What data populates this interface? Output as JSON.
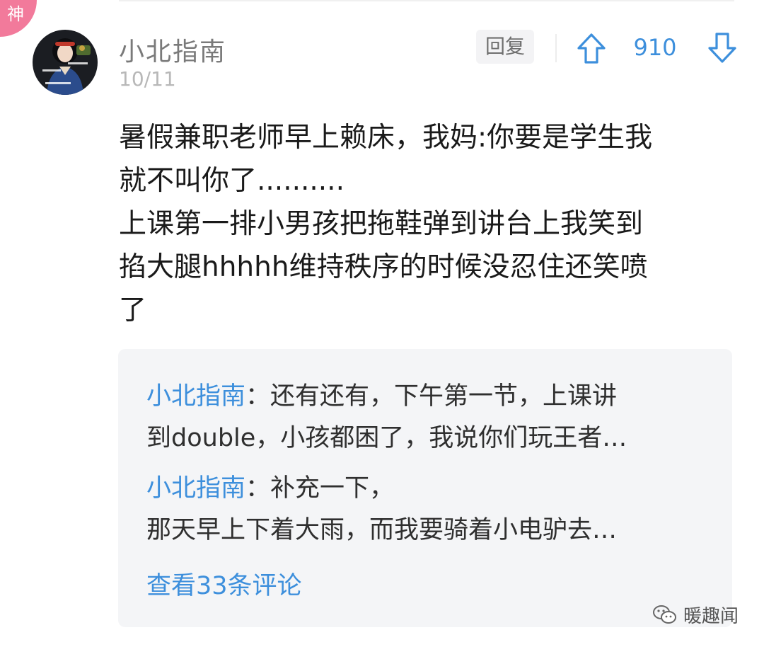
{
  "badge": {
    "label": "神"
  },
  "comment": {
    "author": "小北指南",
    "date": "10/11",
    "reply_label": "回复",
    "vote_count": "910",
    "body": [
      "暑假兼职老师早上赖床，我妈:你要是学生我\n就不叫你了..........",
      "上课第一排小男孩把拖鞋弹到讲台上我笑到\n掐大腿hhhhh维持秩序的时候没忍住还笑喷\n了"
    ]
  },
  "replies": [
    {
      "author": "小北指南",
      "separator": "：",
      "line1": "还有还有，下午第一节，上课讲",
      "line2": "到double，小孩都困了，我说你们玩王者…"
    },
    {
      "author": "小北指南",
      "separator": "：",
      "line1": "补充一下，",
      "line2": "那天早上下着大雨，而我要骑着小电驴去…"
    }
  ],
  "view_more": "查看33条评论",
  "watermark": "暖趣闻",
  "colors": {
    "accent_blue": "#3d8fdc",
    "badge_pink": "#f27a9b",
    "reply_box_bg": "#f4f5f7"
  },
  "icons": {
    "upvote": "arrow-up-outline-icon",
    "downvote": "arrow-down-outline-icon",
    "watermark": "wechat-logo-icon"
  }
}
